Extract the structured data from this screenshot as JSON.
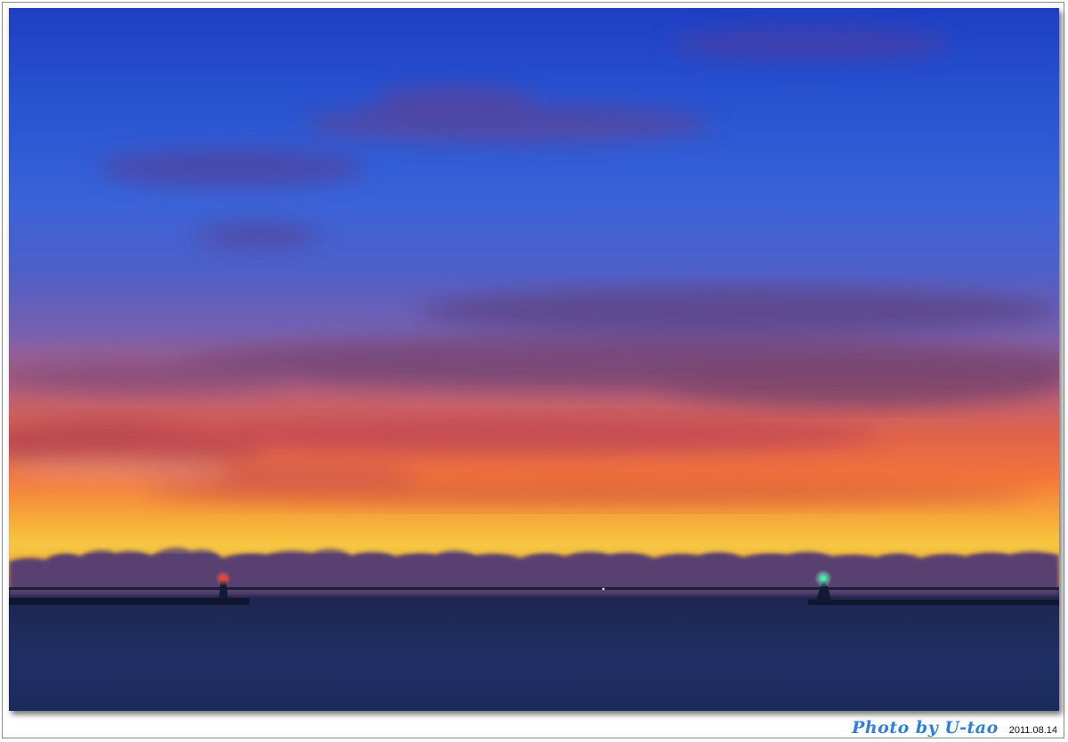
{
  "photo": {
    "subject": "sunset",
    "colors": {
      "sky_top": "#1d3fc4",
      "horizon_glow": "#f6c43c",
      "sea": "#1f2f66",
      "left_beacon": "#ff3a2a",
      "right_beacon": "#2cff9a"
    }
  },
  "caption": {
    "signature": "Photo by U-tao",
    "date": "2011.08.14"
  }
}
